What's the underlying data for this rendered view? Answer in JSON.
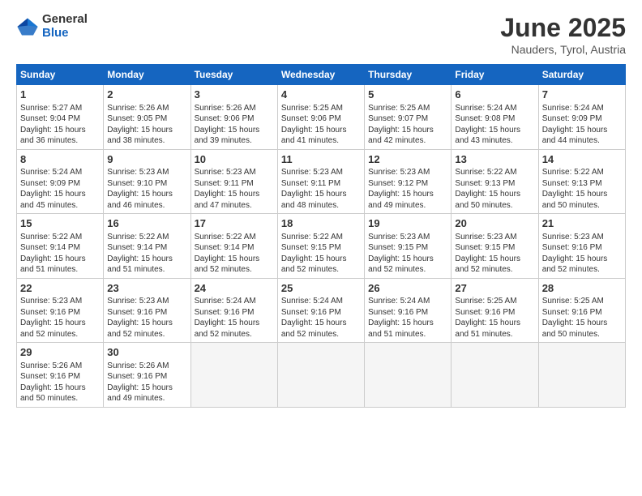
{
  "logo": {
    "general": "General",
    "blue": "Blue"
  },
  "title": "June 2025",
  "subtitle": "Nauders, Tyrol, Austria",
  "weekdays": [
    "Sunday",
    "Monday",
    "Tuesday",
    "Wednesday",
    "Thursday",
    "Friday",
    "Saturday"
  ],
  "weeks": [
    [
      {
        "day": 1,
        "lines": [
          "Sunrise: 5:27 AM",
          "Sunset: 9:04 PM",
          "Daylight: 15 hours",
          "and 36 minutes."
        ]
      },
      {
        "day": 2,
        "lines": [
          "Sunrise: 5:26 AM",
          "Sunset: 9:05 PM",
          "Daylight: 15 hours",
          "and 38 minutes."
        ]
      },
      {
        "day": 3,
        "lines": [
          "Sunrise: 5:26 AM",
          "Sunset: 9:06 PM",
          "Daylight: 15 hours",
          "and 39 minutes."
        ]
      },
      {
        "day": 4,
        "lines": [
          "Sunrise: 5:25 AM",
          "Sunset: 9:06 PM",
          "Daylight: 15 hours",
          "and 41 minutes."
        ]
      },
      {
        "day": 5,
        "lines": [
          "Sunrise: 5:25 AM",
          "Sunset: 9:07 PM",
          "Daylight: 15 hours",
          "and 42 minutes."
        ]
      },
      {
        "day": 6,
        "lines": [
          "Sunrise: 5:24 AM",
          "Sunset: 9:08 PM",
          "Daylight: 15 hours",
          "and 43 minutes."
        ]
      },
      {
        "day": 7,
        "lines": [
          "Sunrise: 5:24 AM",
          "Sunset: 9:09 PM",
          "Daylight: 15 hours",
          "and 44 minutes."
        ]
      }
    ],
    [
      {
        "day": 8,
        "lines": [
          "Sunrise: 5:24 AM",
          "Sunset: 9:09 PM",
          "Daylight: 15 hours",
          "and 45 minutes."
        ]
      },
      {
        "day": 9,
        "lines": [
          "Sunrise: 5:23 AM",
          "Sunset: 9:10 PM",
          "Daylight: 15 hours",
          "and 46 minutes."
        ]
      },
      {
        "day": 10,
        "lines": [
          "Sunrise: 5:23 AM",
          "Sunset: 9:11 PM",
          "Daylight: 15 hours",
          "and 47 minutes."
        ]
      },
      {
        "day": 11,
        "lines": [
          "Sunrise: 5:23 AM",
          "Sunset: 9:11 PM",
          "Daylight: 15 hours",
          "and 48 minutes."
        ]
      },
      {
        "day": 12,
        "lines": [
          "Sunrise: 5:23 AM",
          "Sunset: 9:12 PM",
          "Daylight: 15 hours",
          "and 49 minutes."
        ]
      },
      {
        "day": 13,
        "lines": [
          "Sunrise: 5:22 AM",
          "Sunset: 9:13 PM",
          "Daylight: 15 hours",
          "and 50 minutes."
        ]
      },
      {
        "day": 14,
        "lines": [
          "Sunrise: 5:22 AM",
          "Sunset: 9:13 PM",
          "Daylight: 15 hours",
          "and 50 minutes."
        ]
      }
    ],
    [
      {
        "day": 15,
        "lines": [
          "Sunrise: 5:22 AM",
          "Sunset: 9:14 PM",
          "Daylight: 15 hours",
          "and 51 minutes."
        ]
      },
      {
        "day": 16,
        "lines": [
          "Sunrise: 5:22 AM",
          "Sunset: 9:14 PM",
          "Daylight: 15 hours",
          "and 51 minutes."
        ]
      },
      {
        "day": 17,
        "lines": [
          "Sunrise: 5:22 AM",
          "Sunset: 9:14 PM",
          "Daylight: 15 hours",
          "and 52 minutes."
        ]
      },
      {
        "day": 18,
        "lines": [
          "Sunrise: 5:22 AM",
          "Sunset: 9:15 PM",
          "Daylight: 15 hours",
          "and 52 minutes."
        ]
      },
      {
        "day": 19,
        "lines": [
          "Sunrise: 5:23 AM",
          "Sunset: 9:15 PM",
          "Daylight: 15 hours",
          "and 52 minutes."
        ]
      },
      {
        "day": 20,
        "lines": [
          "Sunrise: 5:23 AM",
          "Sunset: 9:15 PM",
          "Daylight: 15 hours",
          "and 52 minutes."
        ]
      },
      {
        "day": 21,
        "lines": [
          "Sunrise: 5:23 AM",
          "Sunset: 9:16 PM",
          "Daylight: 15 hours",
          "and 52 minutes."
        ]
      }
    ],
    [
      {
        "day": 22,
        "lines": [
          "Sunrise: 5:23 AM",
          "Sunset: 9:16 PM",
          "Daylight: 15 hours",
          "and 52 minutes."
        ]
      },
      {
        "day": 23,
        "lines": [
          "Sunrise: 5:23 AM",
          "Sunset: 9:16 PM",
          "Daylight: 15 hours",
          "and 52 minutes."
        ]
      },
      {
        "day": 24,
        "lines": [
          "Sunrise: 5:24 AM",
          "Sunset: 9:16 PM",
          "Daylight: 15 hours",
          "and 52 minutes."
        ]
      },
      {
        "day": 25,
        "lines": [
          "Sunrise: 5:24 AM",
          "Sunset: 9:16 PM",
          "Daylight: 15 hours",
          "and 52 minutes."
        ]
      },
      {
        "day": 26,
        "lines": [
          "Sunrise: 5:24 AM",
          "Sunset: 9:16 PM",
          "Daylight: 15 hours",
          "and 51 minutes."
        ]
      },
      {
        "day": 27,
        "lines": [
          "Sunrise: 5:25 AM",
          "Sunset: 9:16 PM",
          "Daylight: 15 hours",
          "and 51 minutes."
        ]
      },
      {
        "day": 28,
        "lines": [
          "Sunrise: 5:25 AM",
          "Sunset: 9:16 PM",
          "Daylight: 15 hours",
          "and 50 minutes."
        ]
      }
    ],
    [
      {
        "day": 29,
        "lines": [
          "Sunrise: 5:26 AM",
          "Sunset: 9:16 PM",
          "Daylight: 15 hours",
          "and 50 minutes."
        ]
      },
      {
        "day": 30,
        "lines": [
          "Sunrise: 5:26 AM",
          "Sunset: 9:16 PM",
          "Daylight: 15 hours",
          "and 49 minutes."
        ]
      },
      null,
      null,
      null,
      null,
      null
    ]
  ]
}
